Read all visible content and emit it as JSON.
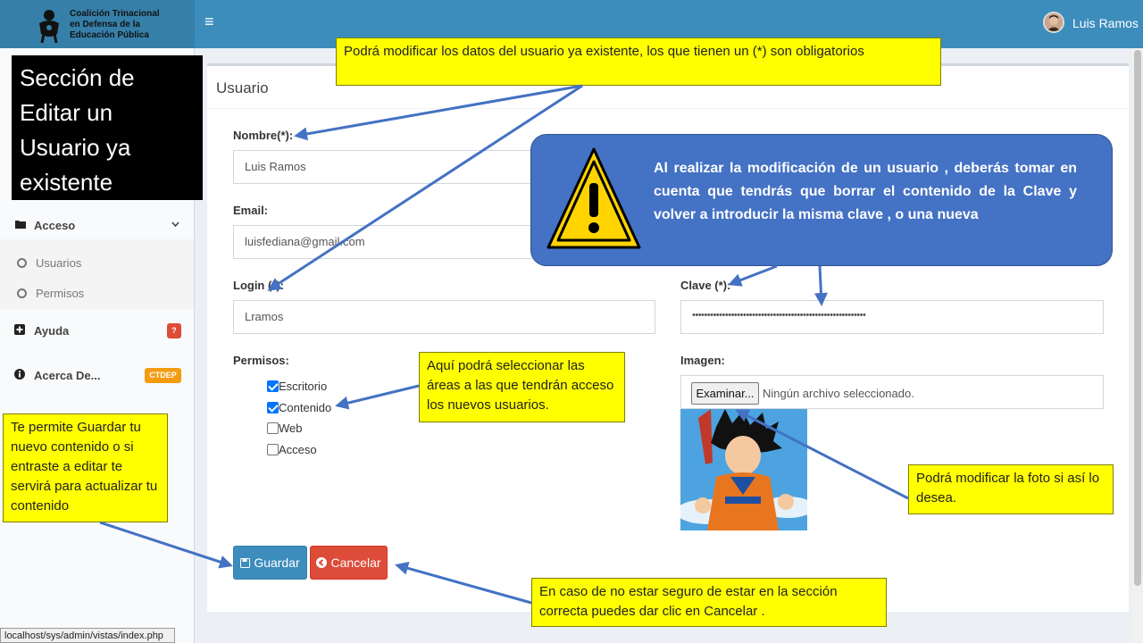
{
  "header": {
    "org_line1": "Coalición Trinacional",
    "org_line2": "en Defensa de la",
    "org_line3": "Educación Pública",
    "menu_icon": "≡",
    "user_name": "Luis Ramos"
  },
  "sidebar": {
    "acceso_label": "Acceso",
    "usuarios_label": "Usuarios",
    "permisos_label": "Permisos",
    "ayuda_label": "Ayuda",
    "ayuda_badge": "?",
    "acerca_label": "Acerca De...",
    "acerca_badge": "CTDEP"
  },
  "status_url": "localhost/sys/admin/vistas/index.php",
  "form": {
    "box_title": "Usuario",
    "nombre_label": "Nombre(*):",
    "nombre_value": "Luis Ramos",
    "email_label": "Email:",
    "email_value": "luisfediana@gmail.com",
    "login_label": "Login (*):",
    "login_value": "Lramos",
    "clave_label": "Clave (*):",
    "clave_value": "••••••••••••••••••••••••••••••••••••••••••••••••••••••••••",
    "permisos_label": "Permisos:",
    "permisos": [
      {
        "label": "Escritorio",
        "checked": true
      },
      {
        "label": "Contenido",
        "checked": true
      },
      {
        "label": "Web",
        "checked": false
      },
      {
        "label": "Acceso",
        "checked": false
      }
    ],
    "imagen_label": "Imagen:",
    "browse_label": "Examinar...",
    "file_status": "Ningún archivo seleccionado.",
    "save_label": "Guardar",
    "cancel_label": "Cancelar"
  },
  "annotations": {
    "section_title": "Sección de Editar un Usuario ya existente",
    "top_note": "Podrá modificar los datos del usuario ya existente, los que tienen un (*) son obligatorios",
    "warning": "Al realizar la modificación de un usuario , deberás tomar en cuenta que tendrás que borrar  el contenido de la Clave y volver a introducir la misma clave , o una nueva",
    "permisos_note": "Aquí podrá seleccionar las áreas a las que tendrán acceso los nuevos usuarios.",
    "guardar_note": "Te permite Guardar tu nuevo contenido o si entraste a editar te servirá para actualizar tu contenido",
    "photo_note": "Podrá modificar la foto si así lo desea.",
    "cancel_note": "En caso de no estar seguro de estar en la sección correcta puedes dar clic en Cancelar ."
  },
  "colors": {
    "header": "#3c8dbc",
    "save_button": "#3c8dbc",
    "cancel_button": "#dd4b39",
    "note_yellow": "#ffff00",
    "warning_blue": "#4472c4"
  }
}
